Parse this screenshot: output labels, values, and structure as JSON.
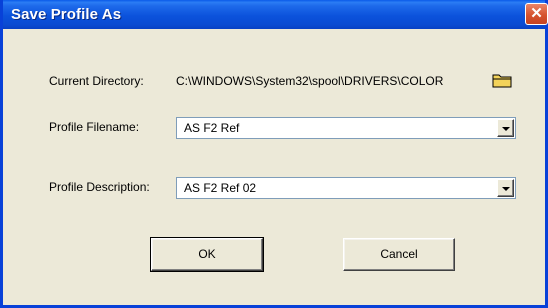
{
  "window": {
    "title": "Save Profile As",
    "close_glyph": "✕"
  },
  "current_directory": {
    "label": "Current Directory:",
    "value": "C:\\WINDOWS\\System32\\spool\\DRIVERS\\COLOR",
    "icon": "folder-icon"
  },
  "profile_filename": {
    "label": "Profile Filename:",
    "value": "AS F2 Ref"
  },
  "profile_description": {
    "label": "Profile Description:",
    "value": "AS F2 Ref 02"
  },
  "buttons": {
    "ok": "OK",
    "cancel": "Cancel"
  },
  "colors": {
    "titlebar": "#0a4bd2",
    "close": "#d6532e",
    "face": "#ece9d8",
    "folder": "#f3d35a"
  }
}
